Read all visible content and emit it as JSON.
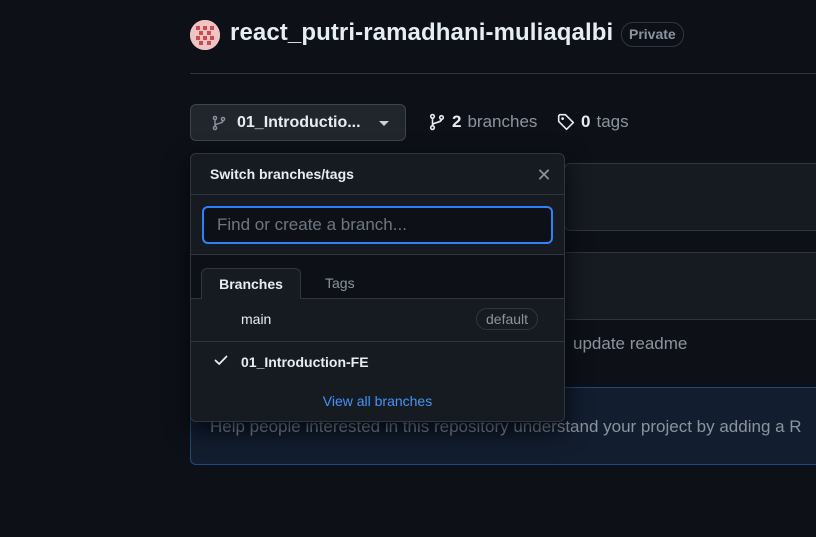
{
  "repo": {
    "name": "react_putri-ramadhani-muliaqalbi",
    "visibility": "Private"
  },
  "branch_selector": {
    "current": "01_Introductio...",
    "branches_count": "2",
    "branches_label": "branches",
    "tags_count": "0",
    "tags_label": "tags"
  },
  "dropdown": {
    "title": "Switch branches/tags",
    "search_placeholder": "Find or create a branch...",
    "tabs": [
      "Branches",
      "Tags"
    ],
    "branches": [
      {
        "name": "main",
        "badge": "default",
        "selected": false
      },
      {
        "name": "01_Introduction-FE",
        "badge": "",
        "selected": true
      }
    ],
    "view_all": "View all branches"
  },
  "background": {
    "commit_message": "update readme",
    "readme_prompt": "Help people interested in this repository understand your project by adding a R"
  },
  "colors": {
    "accent": "#2f81f7",
    "link": "#4493f8",
    "bg": "#0d1117"
  }
}
